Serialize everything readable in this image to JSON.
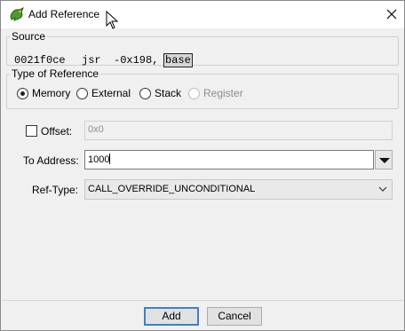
{
  "dialog": {
    "title": "Add Reference",
    "icon": "dragon-icon",
    "close_icon": "close-icon"
  },
  "source": {
    "legend": "Source",
    "address": "0021f0ce",
    "mnemonic": "jsr",
    "operand_prefix": "-0x198,",
    "operand_selected": "base"
  },
  "reference_type": {
    "legend": "Type of Reference",
    "options": [
      {
        "label": "Memory",
        "checked": true,
        "enabled": true
      },
      {
        "label": "External",
        "checked": false,
        "enabled": true
      },
      {
        "label": "Stack",
        "checked": false,
        "enabled": true
      },
      {
        "label": "Register",
        "checked": false,
        "enabled": false
      }
    ]
  },
  "offset": {
    "label": "Offset:",
    "checked": false,
    "value": "0x0"
  },
  "to_address": {
    "label": "To Address:",
    "value": "1000"
  },
  "ref_type": {
    "label": "Ref-Type:",
    "selected": "CALL_OVERRIDE_UNCONDITIONAL"
  },
  "buttons": {
    "add": "Add",
    "cancel": "Cancel"
  },
  "colors": {
    "default_button_border": "#3c7fd0",
    "window_bg": "#f0f0f0",
    "title_bg": "#ffffff"
  }
}
